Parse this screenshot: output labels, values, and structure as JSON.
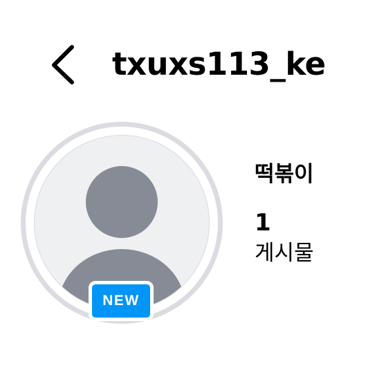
{
  "header": {
    "back_icon": "chevron-left-icon",
    "username": "txuxs113_ke"
  },
  "profile": {
    "avatar_icon": "default-user-icon",
    "badge": "NEW",
    "display_name": "떡볶이",
    "posts": {
      "count": "1",
      "label": "게시물"
    }
  },
  "colors": {
    "badge_bg": "#0095f6",
    "avatar_ring": "#dbdce2",
    "avatar_bg": "#eff0f2",
    "avatar_silhouette": "#878b95"
  }
}
